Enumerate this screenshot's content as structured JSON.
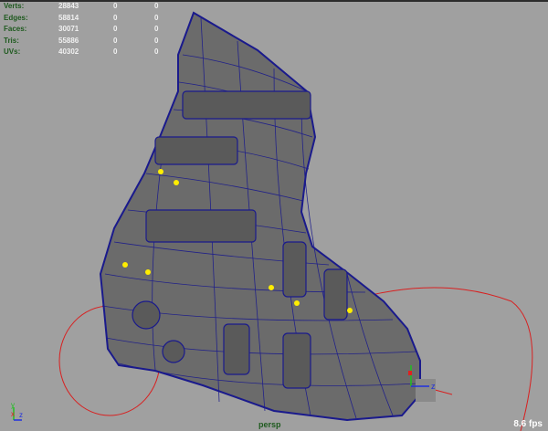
{
  "hud": {
    "rows": [
      {
        "label": "Verts:",
        "value": "28843",
        "sel": "0",
        "comp": "0"
      },
      {
        "label": "Edges:",
        "value": "58814",
        "sel": "0",
        "comp": "0"
      },
      {
        "label": "Faces:",
        "value": "30071",
        "sel": "0",
        "comp": "0"
      },
      {
        "label": "Tris:",
        "value": "55886",
        "sel": "0",
        "comp": "0"
      },
      {
        "label": "UVs:",
        "value": "40302",
        "sel": "0",
        "comp": "0"
      }
    ]
  },
  "viewport": {
    "camera": "persp",
    "fps": "8.6 fps"
  },
  "axes": {
    "x": "x",
    "y": "y",
    "z": "z"
  },
  "colors": {
    "background": "#a0a0a0",
    "wire": "#1a1a8c",
    "mesh": "#6a6a6a",
    "manip": "#e02020",
    "hud_label": "#1e5a1e"
  }
}
